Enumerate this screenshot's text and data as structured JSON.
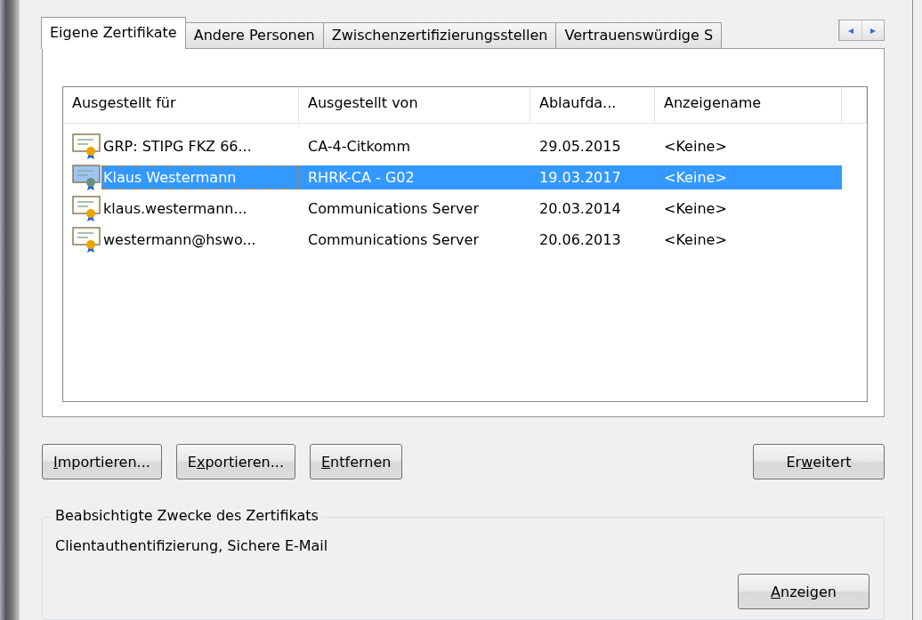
{
  "tabs": [
    {
      "label": "Eigene Zertifikate",
      "selected": true
    },
    {
      "label": "Andere Personen",
      "selected": false
    },
    {
      "label": "Zwischenzertifizierungsstellen",
      "selected": false
    },
    {
      "label": "Vertrauenswürdige S",
      "selected": false
    }
  ],
  "tab_scroll": [
    "◂",
    "▸"
  ],
  "table": {
    "columns": [
      "Ausgestellt für",
      "Ausgestellt von",
      "Ablaufda...",
      "Anzeigename"
    ],
    "rows": [
      {
        "cells": [
          "GRP: STIPG FKZ 66...",
          "CA-4-Citkomm",
          "29.05.2015",
          "<Keine>"
        ],
        "selected": false
      },
      {
        "cells": [
          "Klaus Westermann",
          "RHRK-CA - G02",
          "19.03.2017",
          "<Keine>"
        ],
        "selected": true
      },
      {
        "cells": [
          "klaus.westermann...",
          "Communications Server",
          "20.03.2014",
          "<Keine>"
        ],
        "selected": false
      },
      {
        "cells": [
          "westermann@hswo...",
          "Communications Server",
          "20.06.2013",
          "<Keine>"
        ],
        "selected": false
      }
    ]
  },
  "buttons": [
    {
      "key": "I",
      "after": "mportieren..."
    },
    {
      "before": "E",
      "key": "x",
      "after": "portieren..."
    },
    {
      "key": "E",
      "after": "ntfernen"
    },
    {
      "before": "Er",
      "key": "w",
      "after": "eitert"
    }
  ],
  "purposes": {
    "title": "Beabsichtigte Zwecke des Zertifikats",
    "text": "Clientauthentifizierung, Sichere E-Mail",
    "button": {
      "key": "A",
      "after": "nzeigen"
    }
  }
}
